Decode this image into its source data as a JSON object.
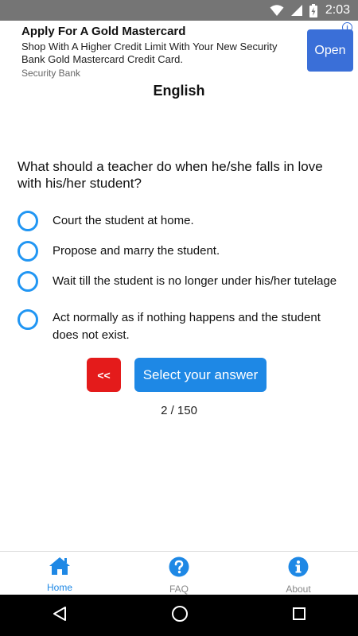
{
  "status_bar": {
    "time": "2:03"
  },
  "ad": {
    "title": "Apply For A Gold Mastercard",
    "description": "Shop With A Higher Credit Limit With Your New Security Bank Gold Mastercard Credit Card.",
    "source": "Security Bank",
    "cta_label": "Open",
    "info_label": "i"
  },
  "quiz": {
    "title": "English",
    "question": "What should a teacher do when he/she falls in love with his/her student?",
    "options": [
      "Court the student at home.",
      "Propose and marry the student.",
      "Wait till the student is no longer under his/her tutelage",
      "Act normally as if nothing happens and the student does not exist."
    ],
    "back_label": "<<",
    "submit_label": "Select your answer",
    "counter": "2 / 150"
  },
  "bottom_nav": {
    "items": [
      {
        "label": "Home",
        "icon": "home-icon",
        "active": true
      },
      {
        "label": "FAQ",
        "icon": "question-icon",
        "active": false
      },
      {
        "label": "About",
        "icon": "info-icon",
        "active": false
      }
    ]
  },
  "colors": {
    "accent": "#1e88e5",
    "back_button": "#e41b1b",
    "radio": "#2196f3",
    "status_bar": "#757575"
  }
}
